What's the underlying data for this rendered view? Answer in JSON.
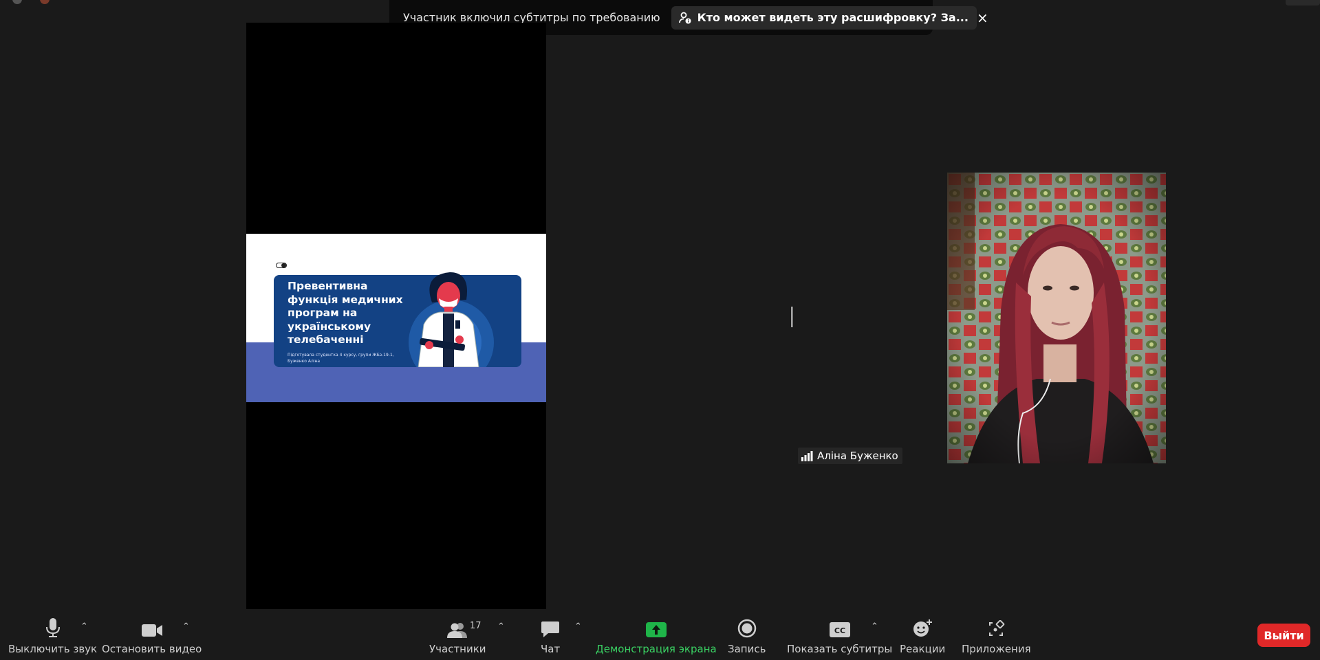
{
  "notification": {
    "message": "Участник включил субтитры по требованию",
    "link": "Кто может видеть эту расшифровку? За...",
    "close": "×"
  },
  "share": {
    "slide_title": "Превентивна функція медичних програм на українському телебаченні",
    "slide_subtitle": "Підготувала студентка 4 курсу, групи ЖБз-19-1, Буженко Аліна"
  },
  "participant": {
    "name": "Аліна Буженко"
  },
  "toolbar": {
    "mute": "Выключить звук",
    "stop_video": "Остановить видео",
    "participants": "Участники",
    "participants_count": "17",
    "chat": "Чат",
    "share_screen": "Демонстрация экрана",
    "record": "Запись",
    "captions": "Показать субтитры",
    "captions_icon_text": "CC",
    "reactions": "Реакции",
    "apps": "Приложения",
    "leave": "Выйти"
  },
  "colors": {
    "background": "#1a1a1a",
    "share_green": "#3ad163",
    "leave_red": "#e02828",
    "slide_card": "#134284",
    "slide_band": "#4f63b5"
  }
}
